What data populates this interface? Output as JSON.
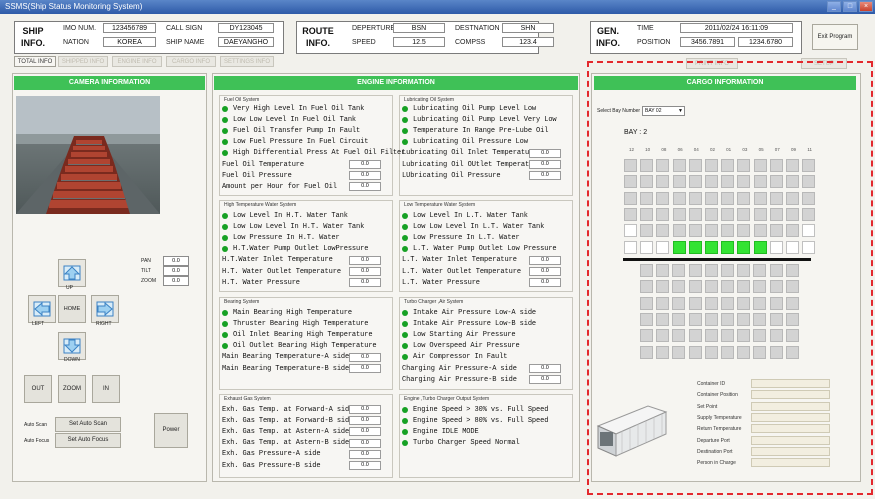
{
  "window": {
    "title": "SSMS(Ship Status Monitoring System)",
    "min": "_",
    "max": "□",
    "close": "×"
  },
  "ship": {
    "title_line1": "SHIP",
    "title_line2": "INFO.",
    "imo_label": "IMO NUM.",
    "imo": "123456789",
    "nation_label": "NATION",
    "nation": "KOREA",
    "callsign_label": "CALL SIGN",
    "callsign": "DY123045",
    "shipname_label": "SHIP NAME",
    "shipname": "DAEYANGHO"
  },
  "route": {
    "title_line1": "ROUTE",
    "title_line2": "INFO.",
    "departure_label": "DEPERTURE",
    "departure": "BSN",
    "speed_label": "SPEED",
    "speed": "12.5",
    "destination_label": "DESTNATION",
    "destination": "SHN",
    "compass_label": "COMPSS",
    "compass": "123.4"
  },
  "gen": {
    "title_line1": "GEN.",
    "title_line2": "INFO.",
    "time_label": "TIME",
    "time": "2011/02/24 16:11:09",
    "position_label": "POSITION",
    "pos_lat": "3456.7891",
    "pos_lon": "1234.6780"
  },
  "exit_label": "Exit Program",
  "tabs": [
    "TOTAL INFO",
    "SHIPPED INFO",
    "ENGINE INFO",
    "CARGO INFO",
    "SETTINGS INFO"
  ],
  "cargo_tabs": [
    "PRINT INFO",
    "SETUP"
  ],
  "camera": {
    "header": "CAMERA INFORMATION",
    "pan_label": "PAN",
    "pan": "0.0",
    "tilt_label": "TILT",
    "tilt": "0.0",
    "zoom_label": "ZOOM",
    "zoom": "0.0",
    "up": "UP",
    "left": "LEFT",
    "home": "HOME",
    "right": "RIGHT",
    "down": "DOWN",
    "out": "OUT",
    "zoomb": "ZOOM",
    "in": "IN",
    "auto_scan_label": "Auto Scan",
    "set_auto_scan": "Set Auto Scan",
    "auto_focus_label": "Auto Focus",
    "set_auto_focus": "Set Auto Focus",
    "power": "Power"
  },
  "engine": {
    "header": "ENGINE INFORMATION",
    "fuel": {
      "title": "Fuel Oil System",
      "alarms": [
        "Very High Level In Fuel Oil Tank",
        "Low Low Level In Fuel Oil Tank",
        "Fuel Oil Transfer Pump In Fault",
        "Low Fuel Pressure In Fuel Circuit",
        "High Differential Press At Fuel Oil Filter"
      ],
      "values": [
        {
          "label": "Fuel Oil Temperature",
          "value": "0.0"
        },
        {
          "label": "Fuel Oil Pressure",
          "value": "0.0"
        },
        {
          "label": "Amount per Hour for Fuel Oil",
          "value": "0.0"
        }
      ]
    },
    "lube": {
      "title": "Lubricating Oil System",
      "alarms": [
        "Lubricating Oil Pump Level Low",
        "Lubricating Oil Pump Level Very Low",
        "Temperature In Range Pre-Lube Oil",
        "Lubricating Oil Pressure Low"
      ],
      "values": [
        {
          "label": "Lubricating Oil Inlet Temperature",
          "value": "0.0"
        },
        {
          "label": "Lubricating Oil OUtlet Temperature",
          "value": "0.0"
        },
        {
          "label": "LUbricating Oil Pressure",
          "value": "0.0"
        }
      ]
    },
    "ht": {
      "title": "High Temperature Water System",
      "alarms": [
        "Low Level In H.T. Water Tank",
        "Low Low Level In H.T. Water Tank",
        "Low Pressure In H.T. Water",
        "H.T.Water Pump Outlet LowPressure"
      ],
      "values": [
        {
          "label": "H.T.Water Inlet Temperature",
          "value": "0.0"
        },
        {
          "label": "H.T. Water Outlet Temperature",
          "value": "0.0"
        },
        {
          "label": "H.T. Water Pressure",
          "value": "0.0"
        }
      ]
    },
    "lt": {
      "title": "Low Temperature Water System",
      "alarms": [
        "Low Level In L.T. Water Tank",
        "Low Low Level In L.T. Water Tank",
        "Low Pressure In L.T. Water",
        "L.T. Water Pump Outlet Low Pressure"
      ],
      "values": [
        {
          "label": "L.T. Water Inlet Temperature",
          "value": "0.0"
        },
        {
          "label": "L.T. Water Outlet Temperature",
          "value": "0.0"
        },
        {
          "label": "L.T. Water Pressure",
          "value": "0.0"
        }
      ]
    },
    "bearing": {
      "title": "Bearing System",
      "alarms": [
        "Main Bearing High Temperature",
        "Thruster Bearing High Temperature",
        "Oil Inlet Bearing High Temperature",
        "Oil Outlet Bearing High Temperature"
      ],
      "values": [
        {
          "label": "Main Bearing Temperature-A side",
          "value": "0.0"
        },
        {
          "label": "Main Bearing Temperature-B side",
          "value": "0.0"
        }
      ]
    },
    "turbo": {
      "title": "Turbo Charger ,Air System",
      "alarms": [
        "Intake Air Pressure Low-A side",
        "Intake Air Pressure Low-B side",
        "Low Starting Air Pressure",
        "Low Overspeed Air Pressure",
        "Air Compressor In Fault"
      ],
      "values": [
        {
          "label": "Charging Air Pressure-A side",
          "value": "0.0"
        },
        {
          "label": "Charging Air Pressure-B side",
          "value": "0.0"
        }
      ]
    },
    "exhaust": {
      "title": "Exhaust Gas System",
      "values": [
        {
          "label": "Exh. Gas Temp. at Forward-A side",
          "value": "0.0"
        },
        {
          "label": "Exh. Gas Temp. at Forward-B side",
          "value": "0.0"
        },
        {
          "label": "Exh. Gas Temp. at Astern-A side",
          "value": "0.0"
        },
        {
          "label": "Exh. Gas Temp. at Astern-B side",
          "value": "0.0"
        },
        {
          "label": "Exh. Gas Pressure-A side",
          "value": "0.0"
        },
        {
          "label": "Exh. Gas Pressure-B side",
          "value": "0.0"
        }
      ]
    },
    "engine_turbo": {
      "title": "Engine ,Turbo Charger Output System",
      "alarms": [
        "Engine Speed > 30% vs. Full Speed",
        "Engine Speed > 80% vs. Full Speed",
        "Engine IDLE MODE",
        "Turbo Charger Speed Normal"
      ]
    }
  },
  "cargo": {
    "header": "CARGO INFORMATION",
    "select_label": "Select Bay Number",
    "bay_value": "BAY 02",
    "bay_title": "BAY : 2",
    "columns": [
      "12",
      "10",
      "08",
      "06",
      "04",
      "02",
      "01",
      "03",
      "05",
      "07",
      "09",
      "11"
    ],
    "fields": [
      "Container ID",
      "Container Position",
      "Set Point",
      "Supply Temperature",
      "Return Temperature",
      "Departure Port",
      "Destination Port",
      "Person in Charge"
    ]
  },
  "colors": {
    "green_header": "#3fc157",
    "indicator": "#17a124",
    "occupied": "#33e333",
    "highlight": "#e3282d"
  }
}
